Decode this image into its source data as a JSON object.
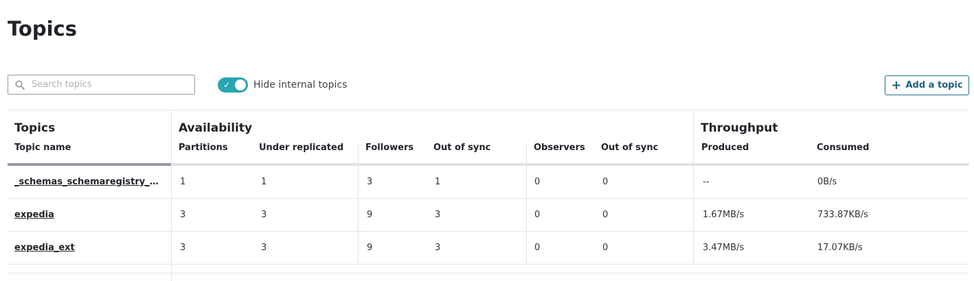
{
  "page": {
    "title": "Topics"
  },
  "search": {
    "placeholder": "Search topics",
    "value": ""
  },
  "toggle": {
    "label": "Hide internal topics",
    "on": true
  },
  "add_button": {
    "label": "Add a topic"
  },
  "table": {
    "groups": {
      "topics": "Topics",
      "availability": "Availability",
      "throughput": "Throughput"
    },
    "columns": {
      "topic_name": "Topic name",
      "partitions": "Partitions",
      "under_replicated": "Under replicated",
      "followers": "Followers",
      "followers_out_of_sync": "Out of sync",
      "observers": "Observers",
      "observers_out_of_sync": "Out of sync",
      "produced": "Produced",
      "consumed": "Consumed"
    },
    "rows": [
      {
        "name": "_schemas_schemaregistry_co...",
        "partitions": "1",
        "under_replicated": "1",
        "followers": "3",
        "followers_out_of_sync": "1",
        "observers": "0",
        "observers_out_of_sync": "0",
        "produced": "--",
        "consumed": "0B/s"
      },
      {
        "name": "expedia",
        "partitions": "3",
        "under_replicated": "3",
        "followers": "9",
        "followers_out_of_sync": "3",
        "observers": "0",
        "observers_out_of_sync": "0",
        "produced": "1.67MB/s",
        "consumed": "733.87KB/s"
      },
      {
        "name": "expedia_ext",
        "partitions": "3",
        "under_replicated": "3",
        "followers": "9",
        "followers_out_of_sync": "3",
        "observers": "0",
        "observers_out_of_sync": "0",
        "produced": "3.47MB/s",
        "consumed": "17.07KB/s"
      }
    ]
  },
  "colors": {
    "accent": "#2aa5b2",
    "button_border": "#1f6f8b",
    "button_text": "#1f5e80"
  }
}
